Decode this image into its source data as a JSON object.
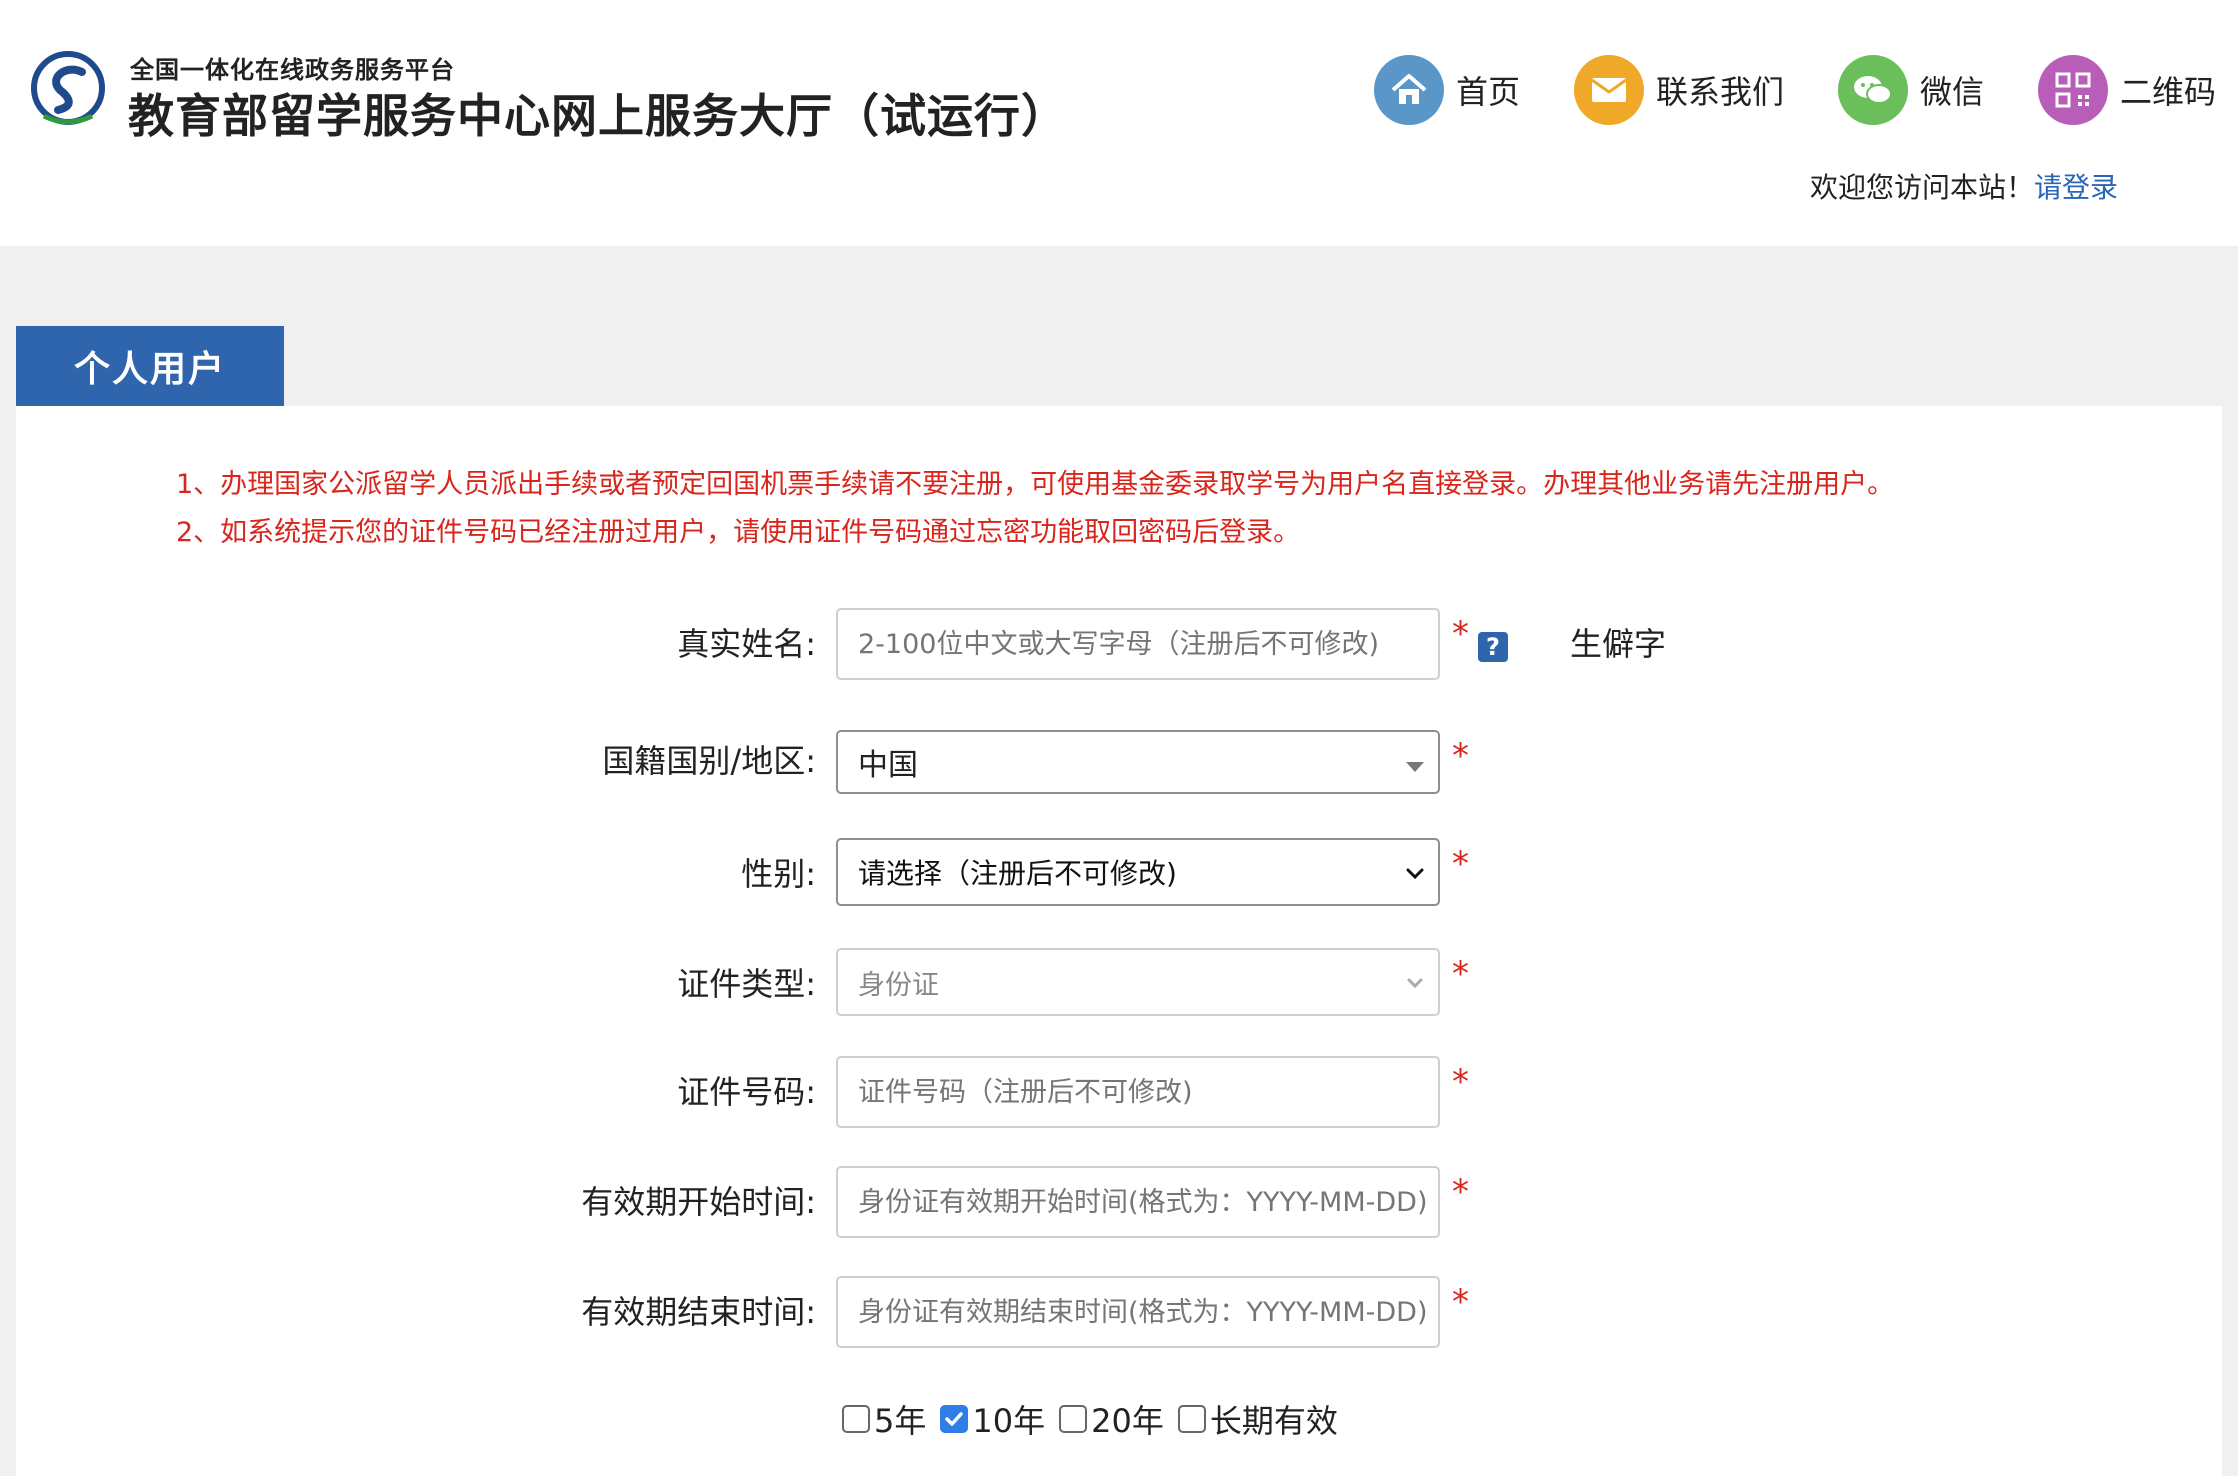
{
  "header": {
    "platform": "全国一体化在线政务服务平台",
    "title": "教育部留学服务中心网上服务大厅（试运行）",
    "nav": [
      {
        "label": "首页",
        "icon": "home-icon",
        "color": "#5a96c8"
      },
      {
        "label": "联系我们",
        "icon": "mail-icon",
        "color": "#f0a829"
      },
      {
        "label": "微信",
        "icon": "wechat-icon",
        "color": "#6bbf5a"
      },
      {
        "label": "二维码",
        "icon": "qrcode-icon",
        "color": "#b85db8"
      }
    ],
    "welcome": "欢迎您访问本站！",
    "login_link": "请登录"
  },
  "tab": {
    "label": "个人用户"
  },
  "notices": [
    "1、办理国家公派留学人员派出手续或者预定回国机票手续请不要注册，可使用基金委录取学号为用户名直接登录。办理其他业务请先注册用户。",
    "2、如系统提示您的证件号码已经注册过用户，请使用证件号码通过忘密功能取回密码后登录。"
  ],
  "form": {
    "name": {
      "label": "真实姓名:",
      "placeholder": "2-100位中文或大写字母（注册后不可修改)",
      "rare_char": "生僻字",
      "help": "?"
    },
    "nationality": {
      "label": "国籍国别/地区:",
      "value": "中国"
    },
    "gender": {
      "label": "性别:",
      "value": "请选择（注册后不可修改)"
    },
    "id_type": {
      "label": "证件类型:",
      "value": "身份证"
    },
    "id_number": {
      "label": "证件号码:",
      "placeholder": "证件号码（注册后不可修改)"
    },
    "valid_start": {
      "label": "有效期开始时间:",
      "placeholder": "身份证有效期开始时间(格式为：YYYY-MM-DD)"
    },
    "valid_end": {
      "label": "有效期结束时间:",
      "placeholder": "身份证有效期结束时间(格式为：YYYY-MM-DD)"
    },
    "required_mark": "*",
    "validity_options": [
      {
        "label": "5年",
        "checked": false
      },
      {
        "label": "10年",
        "checked": true
      },
      {
        "label": "20年",
        "checked": false
      },
      {
        "label": "长期有效",
        "checked": false
      }
    ]
  },
  "colors": {
    "accent": "#2f65ad",
    "notice": "#d9261c",
    "link": "#2a64b8"
  }
}
